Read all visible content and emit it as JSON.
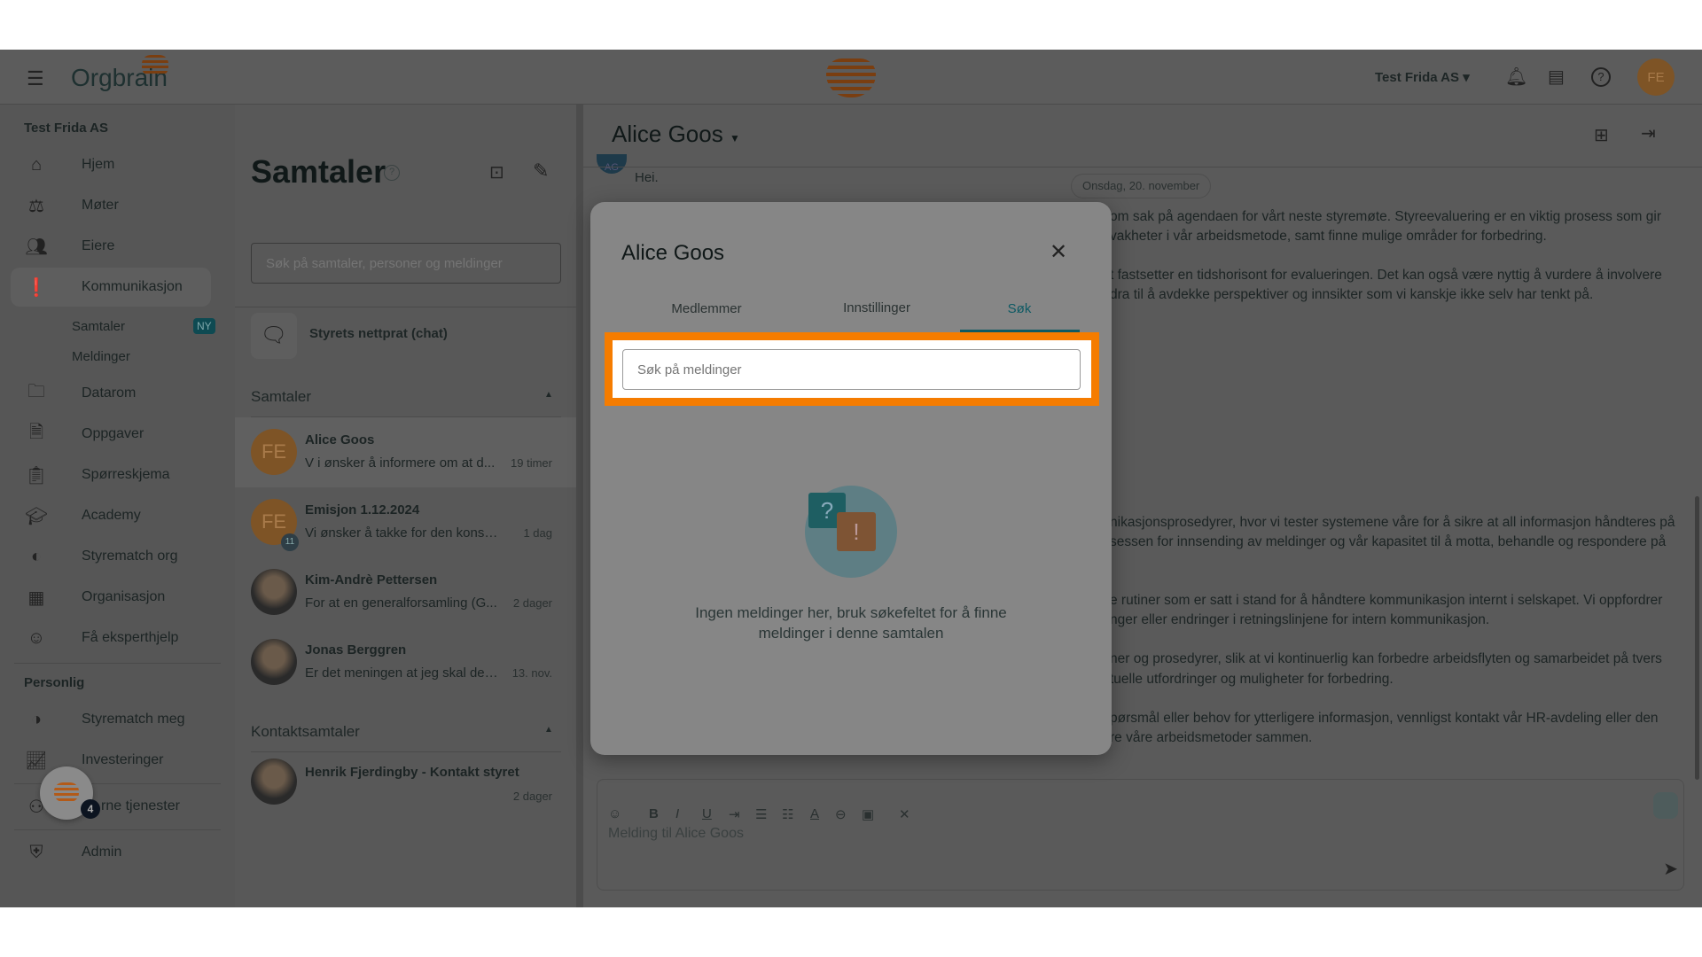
{
  "header": {
    "logo_text": "Orgbrain",
    "org_selector": "Test Frida AS",
    "avatar_initials": "FE"
  },
  "sidebar": {
    "org_name": "Test Frida AS",
    "items": [
      {
        "label": "Hjem",
        "icon": "home-icon"
      },
      {
        "label": "Møter",
        "icon": "gavel-icon"
      },
      {
        "label": "Eiere",
        "icon": "people-icon"
      },
      {
        "label": "Kommunikasjon",
        "icon": "alert-message-icon",
        "active": true
      },
      {
        "label": "Datarom",
        "icon": "folder-icon"
      },
      {
        "label": "Oppgaver",
        "icon": "task-icon"
      },
      {
        "label": "Spørreskjema",
        "icon": "survey-icon"
      },
      {
        "label": "Academy",
        "icon": "graduation-cap-icon"
      },
      {
        "label": "Styrematch org",
        "icon": "styrematch-icon"
      },
      {
        "label": "Organisasjon",
        "icon": "building-icon"
      },
      {
        "label": "Få eksperthjelp",
        "icon": "expert-help-icon"
      }
    ],
    "sub_items": [
      {
        "label": "Samtaler",
        "badge": "NY"
      },
      {
        "label": "Meldinger"
      }
    ],
    "personal_heading": "Personlig",
    "personal_items": [
      {
        "label": "Styrematch meg"
      },
      {
        "label": "Investeringer"
      }
    ],
    "external_visible": "rne tjenester",
    "admin": "Admin",
    "fab_badge": "4"
  },
  "list": {
    "title": "Samtaler",
    "search_placeholder": "Søk på samtaler, personer og meldinger",
    "board_chat": "Styrets nettprat (chat)",
    "section_conversations": "Samtaler",
    "conversations": [
      {
        "name": "Alice Goos",
        "preview": "V i ønsker å informere om at d...",
        "time": "19 timer",
        "initials": "FE",
        "selected": true
      },
      {
        "name": "Emisjon 1.12.2024",
        "preview": "Vi ønsker å takke for den konstru...",
        "time": "1 dag",
        "initials": "FE",
        "badge": "11"
      },
      {
        "name": "Kim-Andrè Pettersen",
        "preview": "For at en generalforsamling (G...",
        "time": "2 dager"
      },
      {
        "name": "Jonas Berggren",
        "preview": "Er det meningen at jeg skal delt...",
        "time": "13. nov."
      }
    ],
    "section_contacts": "Kontaktsamtaler",
    "contacts": [
      {
        "name": "Henrik Fjerdingby - Kontakt styret",
        "time": "2 dager"
      }
    ]
  },
  "chat": {
    "title": "Alice Goos",
    "first_message": "Hei.",
    "sender_initials": "AG",
    "date_chip": "Onsdag, 20. november",
    "lines": [
      "om sak på agendaen for vårt neste styremøte. Styreevaluering er en viktig prosess som gir",
      "vakheter i vår arbeidsmetode, samt finne mulige områder for forbedring.",
      "t fastsetter en tidshorisont for evalueringen. Det kan også være nyttig å vurdere å involvere",
      "dra til å avdekke perspektiver og innsikter som vi kanskje ikke selv har tenkt på.",
      "nikasjonsprosedyrer, hvor vi tester systemene våre for å sikre at all informasjon håndteres på",
      "sessen for innsending av meldinger og vår kapasitet til å motta, behandle og respondere på",
      "e rutiner som er satt i stand for å håndtere kommunikasjon internt i selskapet. Vi oppfordrer",
      "nger eller endringer i retningslinjene for intern kommunikasjon.",
      "ner og prosedyrer, slik at vi kontinuerlig kan forbedre arbeidsflyten og samarbeidet på tvers",
      "tuelle utfordringer og muligheter for forbedring.",
      "pørsmål eller behov for ytterligere informasjon, vennligst kontakt vår HR-avdeling eller den",
      "re våre arbeidsmetoder sammen."
    ],
    "composer_placeholder": "Melding til Alice Goos"
  },
  "modal": {
    "title": "Alice Goos",
    "tabs": [
      {
        "label": "Medlemmer"
      },
      {
        "label": "Innstillinger"
      },
      {
        "label": "Søk",
        "active": true
      }
    ],
    "search_placeholder": "Søk på meldinger",
    "empty_line1": "Ingen meldinger her, bruk søkefeltet for å finne",
    "empty_line2": "meldinger i denne samtalen"
  },
  "colors": {
    "brand_orange": "#c8641e",
    "accent_teal": "#0e5a64",
    "highlight": "#f57c00"
  }
}
